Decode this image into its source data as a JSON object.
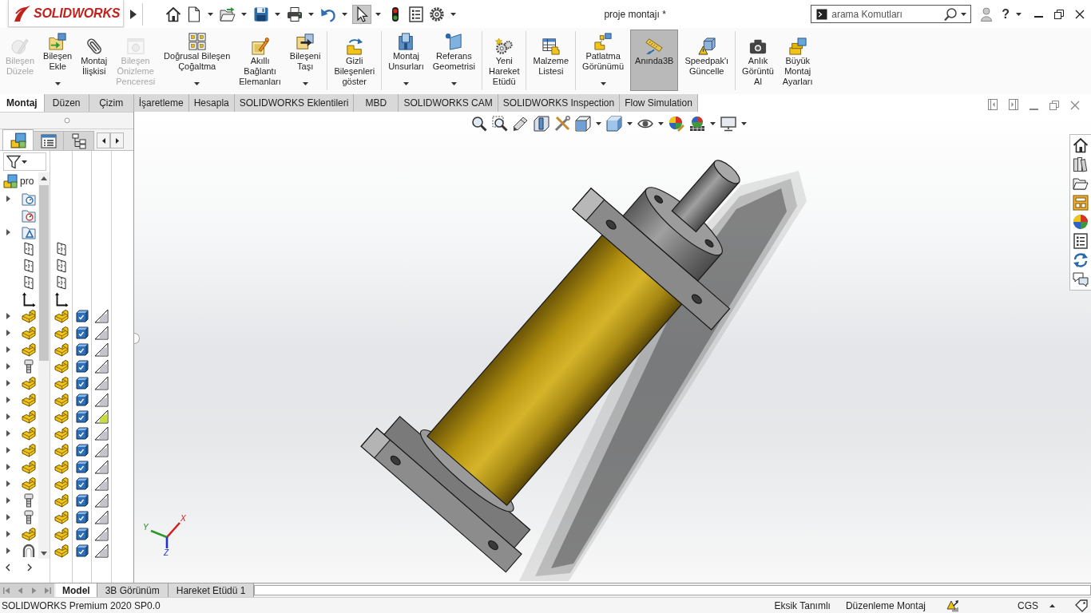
{
  "title_bar": {
    "logo": "SOLIDWORKS",
    "quick_access": [
      {
        "kind": "home",
        "dropdown": false,
        "selected": false
      },
      {
        "kind": "new",
        "dropdown": true,
        "selected": false
      },
      {
        "kind": "open",
        "dropdown": true,
        "selected": false
      },
      {
        "kind": "save",
        "dropdown": true,
        "selected": false
      },
      {
        "kind": "print",
        "dropdown": true,
        "selected": false
      },
      {
        "kind": "undo",
        "dropdown": true,
        "selected": false
      },
      {
        "kind": "select",
        "dropdown": true,
        "selected": true
      },
      {
        "kind": "rebuild",
        "dropdown": false,
        "selected": false
      },
      {
        "kind": "properties",
        "dropdown": false,
        "selected": false
      },
      {
        "kind": "options",
        "dropdown": true,
        "selected": false
      }
    ],
    "title": "proje montajı *",
    "search": {
      "placeholder": "arama Komutları"
    },
    "help": "?"
  },
  "ribbon": {
    "groups": [
      [
        {
          "kind": "edit",
          "label": "Bileşen\nDüzele",
          "disabled": true,
          "dropdown": false,
          "selected": false
        },
        {
          "kind": "insert",
          "label": "Bileşen\nEkle",
          "disabled": false,
          "dropdown": true,
          "selected": false
        },
        {
          "kind": "mate",
          "label": "Montaj\nİlişkisi",
          "disabled": false,
          "dropdown": false,
          "selected": false
        },
        {
          "kind": "preview",
          "label": "Bileşen\nÖnizleme\nPenceresi",
          "disabled": true,
          "dropdown": false,
          "selected": false
        },
        {
          "kind": "pattern",
          "label": "Doğrusal Bileşen\nÇoğaltma",
          "disabled": false,
          "dropdown": true,
          "selected": false
        },
        {
          "kind": "fastener",
          "label": "Akıllı\nBağlantı\nElemanları",
          "disabled": false,
          "dropdown": false,
          "selected": false
        },
        {
          "kind": "move",
          "label": "Bileşeni\nTaşı",
          "disabled": false,
          "dropdown": true,
          "selected": false
        }
      ],
      [
        {
          "kind": "show-hidden",
          "label": "Gizli\nBileşenleri\ngöster",
          "disabled": false,
          "dropdown": false,
          "selected": false
        }
      ],
      [
        {
          "kind": "features",
          "label": "Montaj\nUnsurları",
          "disabled": false,
          "dropdown": true,
          "selected": false
        },
        {
          "kind": "reference",
          "label": "Referans\nGeometrisi",
          "disabled": false,
          "dropdown": true,
          "selected": false
        }
      ],
      [
        {
          "kind": "motion",
          "label": "Yeni\nHareket\nEtüdü",
          "disabled": false,
          "dropdown": false,
          "selected": false
        }
      ],
      [
        {
          "kind": "bom",
          "label": "Malzeme\nListesi",
          "disabled": false,
          "dropdown": false,
          "selected": false
        }
      ],
      [
        {
          "kind": "explode",
          "label": "Patlatma\nGörünümü",
          "disabled": false,
          "dropdown": true,
          "selected": false
        },
        {
          "kind": "instant3d",
          "label": "Anında3B",
          "disabled": false,
          "dropdown": false,
          "selected": true
        },
        {
          "kind": "speedpak",
          "label": "Speedpak'ı\nGüncelle",
          "disabled": false,
          "dropdown": false,
          "selected": false
        }
      ],
      [
        {
          "kind": "snapshot",
          "label": "Anlık\nGörüntü\nAl",
          "disabled": false,
          "dropdown": false,
          "selected": false
        },
        {
          "kind": "large-assembly",
          "label": "Büyük\nMontaj\nAyarları",
          "disabled": false,
          "dropdown": false,
          "selected": false
        }
      ]
    ]
  },
  "command_tabs": [
    {
      "label": "Montaj",
      "selected": true
    },
    {
      "label": "Düzen",
      "selected": false
    },
    {
      "label": "Çizim",
      "selected": false
    },
    {
      "label": "İşaretleme",
      "selected": false
    },
    {
      "label": "Hesapla",
      "selected": false
    },
    {
      "label": "SOLIDWORKS Eklentileri",
      "selected": false
    },
    {
      "label": "MBD",
      "selected": false
    },
    {
      "label": "SOLIDWORKS CAM",
      "selected": false
    },
    {
      "label": "SOLIDWORKS Inspection",
      "selected": false
    },
    {
      "label": "Flow Simulation",
      "selected": false
    }
  ],
  "feature_manager": {
    "tabs": [
      {
        "kind": "tree",
        "selected": true
      },
      {
        "kind": "properties",
        "selected": false
      },
      {
        "kind": "configurations",
        "selected": false
      }
    ],
    "root": "pro",
    "rows": [
      {
        "kind": "sensors-folder",
        "expandable": true
      },
      {
        "kind": "table-folder",
        "expandable": false
      },
      {
        "kind": "annotations-folder",
        "expandable": true
      },
      {
        "kind": "plane",
        "expandable": false
      },
      {
        "kind": "plane",
        "expandable": false
      },
      {
        "kind": "plane",
        "expandable": false
      },
      {
        "kind": "origin",
        "expandable": false
      },
      {
        "kind": "part",
        "expandable": true,
        "color": "#c4c4cc"
      },
      {
        "kind": "part",
        "expandable": true,
        "color": "#c4c4cc"
      },
      {
        "kind": "part",
        "expandable": true,
        "color": "#c4c4cc"
      },
      {
        "kind": "bolt",
        "expandable": true,
        "color": "#c4c4cc"
      },
      {
        "kind": "part",
        "expandable": true,
        "color": "#c4c4cc"
      },
      {
        "kind": "part",
        "expandable": true,
        "color": "#c4c4cc"
      },
      {
        "kind": "part",
        "expandable": true,
        "color": "#c8dc3c"
      },
      {
        "kind": "part",
        "expandable": true,
        "color": "#c4c4cc"
      },
      {
        "kind": "part",
        "expandable": true,
        "color": "#c4c4cc"
      },
      {
        "kind": "part",
        "expandable": true,
        "color": "#c4c4cc"
      },
      {
        "kind": "part",
        "expandable": true,
        "color": "#c4c4cc"
      },
      {
        "kind": "bolt",
        "expandable": true,
        "color": "#c4c4cc"
      },
      {
        "kind": "bolt",
        "expandable": true,
        "color": "#c4c4cc"
      },
      {
        "kind": "part",
        "expandable": true,
        "color": "#c4c4cc"
      },
      {
        "kind": "ring",
        "expandable": true,
        "color": "#c4c4cc"
      }
    ]
  },
  "graphics_area": {
    "axis_labels": [
      "X",
      "Y",
      "Z"
    ]
  },
  "bottom_tabs": [
    {
      "label": "Model",
      "selected": true
    },
    {
      "label": "3B Görünüm",
      "selected": false
    },
    {
      "label": "Hareket Etüdü 1",
      "selected": false
    }
  ],
  "status_bar": {
    "product": "SOLIDWORKS Premium 2020 SP0.0",
    "definition": "Eksik Tanımlı",
    "mode": "Düzenleme Montaj",
    "units": "CGS"
  }
}
